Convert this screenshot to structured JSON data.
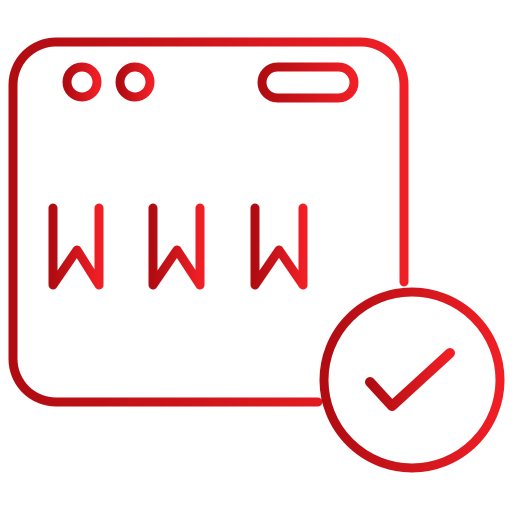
{
  "icon": {
    "name": "verified-website-icon",
    "address_text": "WWW.",
    "parts": {
      "browser": "browser-window-icon",
      "dots": "window-dots-icon",
      "address_bar": "address-bar-icon",
      "badge": "check-badge-icon",
      "check": "checkmark-icon"
    }
  },
  "colors": {
    "gradient_start": "#b00c12",
    "gradient_end": "#f01f26",
    "background": "#ffffff"
  }
}
